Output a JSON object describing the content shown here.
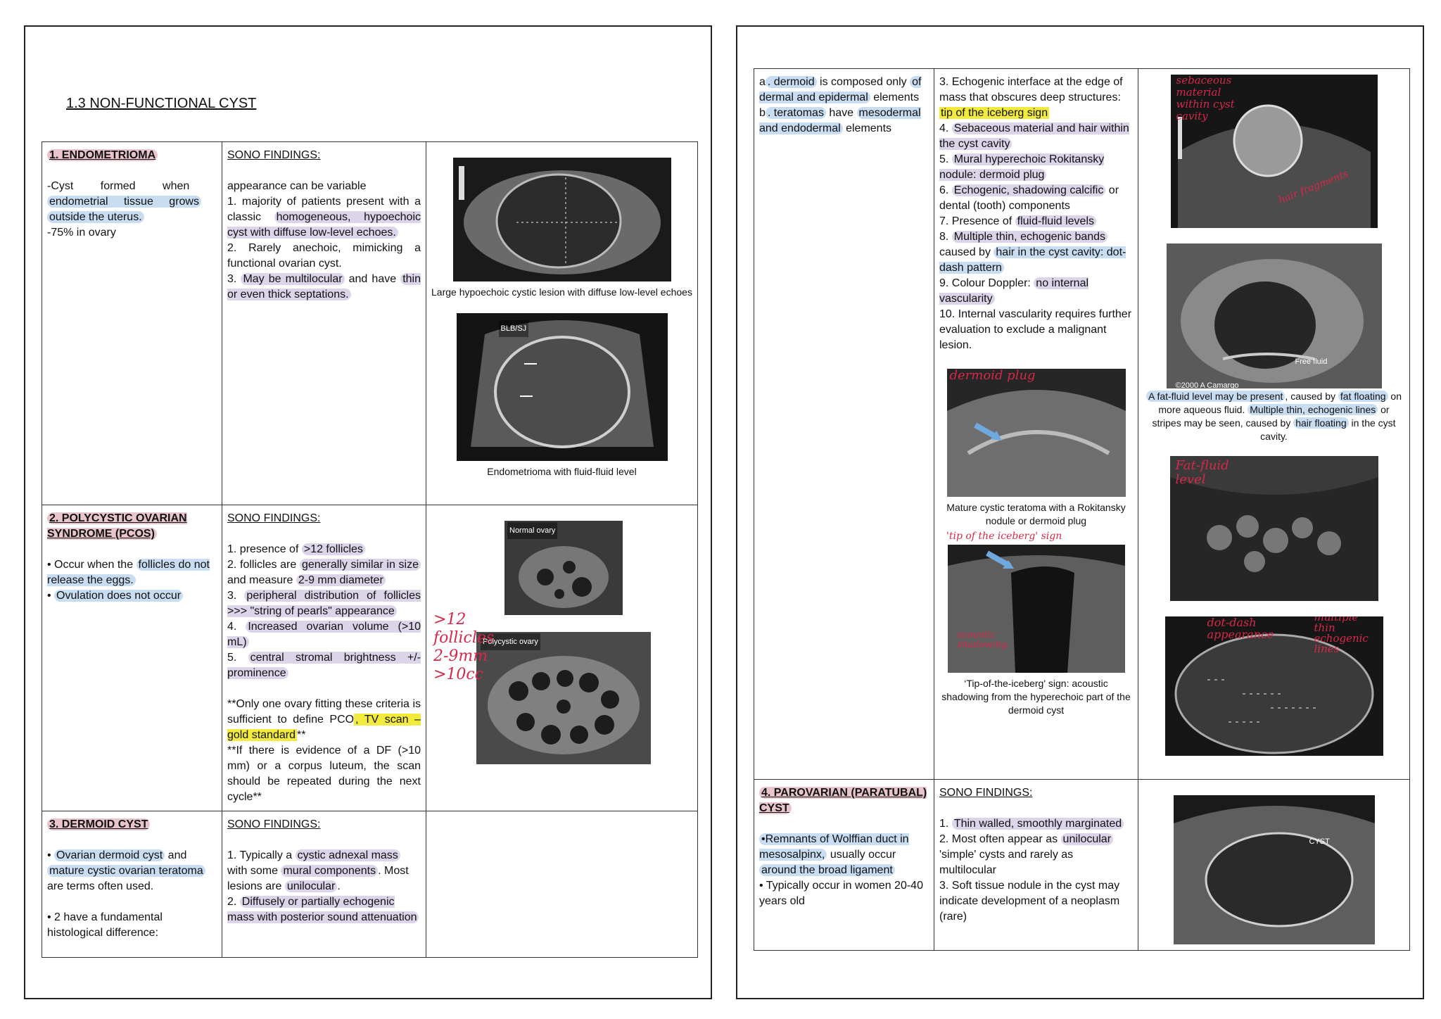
{
  "page1": {
    "title": "1.3 NON-FUNCTIONAL CYST",
    "endometrioma": {
      "heading_num": "1.",
      "heading": "ENDOMETRIOMA",
      "desc1": "-Cyst formed when",
      "desc2": "endometrial tissue grows",
      "desc3": "outside the uterus.",
      "desc4": "-75% in ovary",
      "sono_title": "SONO FINDINGS:",
      "f0": "appearance can be variable",
      "f1a": "1. majority of patients present with a classic ",
      "f1b": "homogeneous, hypoechoic cyst with diffuse low-level echoes.",
      "f2": "2. Rarely anechoic, mimicking a functional ovarian cyst.",
      "f3a": "3. ",
      "f3b": "May be multilocular",
      "f3c": " and have ",
      "f3d": "thin or even thick septations.",
      "caption1": "Large hypoechoic cystic lesion with diffuse low-level echoes",
      "caption2": "Endometrioma with fluid-fluid level",
      "img2_label": "BLB/SJ"
    },
    "pcos": {
      "heading_num": "2.",
      "heading": "POLYCYSTIC OVARIAN SYNDROME (PCOS)",
      "b1a": "• Occur when the ",
      "b1b": "follicles do not release the eggs.",
      "b2": "Ovulation does not occur",
      "b2_bullet": "• ",
      "sono_title": "SONO FINDINGS:",
      "f1a": "1. presence of ",
      "f1b": ">12 follicles",
      "f2a": "2. follicles are ",
      "f2b": "generally similar in size",
      "f2c": " and measure ",
      "f2d": "2-9 mm diameter",
      "f3a": "3. ",
      "f3b": "peripheral distribution of follicles >>> \"string of pearls\" appearance",
      "f4a": "4. ",
      "f4b": "Increased ovarian volume (>10 mL)",
      "f5a": "5. ",
      "f5b": "central stromal brightness +/- prominence",
      "note1a": "**Only one ovary fitting these criteria is sufficient to define PCO",
      "note1b": ", TV scan – gold standard",
      "note1c": "**",
      "note2": "**If there is evidence of a DF (>10 mm) or a corpus luteum, the scan should be repeated during the next cycle**",
      "img1_label": "Normal ovary",
      "img2_label": "Polycystic ovary",
      "scribble": ">12\nfollicles\n2-9mm\n>10cc"
    },
    "dermoid": {
      "heading_num": "3.",
      "heading": "DERMOID CYST",
      "b1a": "• ",
      "b1b": "Ovarian dermoid cyst",
      "b1c": " and ",
      "b1d": "mature cystic ovarian teratoma",
      "b1e": " are terms often used.",
      "b2": "• 2 have a fundamental histological difference:",
      "sono_title": "SONO FINDINGS:",
      "f1a": "1. Typically a ",
      "f1b": "cystic adnexal mass",
      "f1c": " with some ",
      "f1d": "mural components",
      "f1e": ". Most lesions are ",
      "f1f": "unilocular",
      "f1g": ".",
      "f2a": "2. ",
      "f2b": "Diffusely or partially echogenic mass with posterior sound attenuation"
    }
  },
  "page2": {
    "dermoid_cont": {
      "a1": "a",
      "a2": ". dermoid",
      "a3": " is composed only ",
      "a4": "of dermal and epidermal",
      "a5": " elements",
      "b1": "b",
      "b2": ". teratomas",
      "b3": " have ",
      "b4": "mesodermal and endodermal",
      "b5": " elements",
      "f3a": "3. Echogenic interface at the edge of mass that obscures deep structures: ",
      "f3b": "tip of the iceberg sign",
      "f4a": "4. ",
      "f4b": "Sebaceous material and hair within the cyst cavity",
      "f5a": "5. ",
      "f5b": "Mural hyperechoic Rokitansky nodule: dermoid plug",
      "f6a": "6. ",
      "f6b": "Echogenic, shadowing calcific",
      "f6c": " or dental (tooth) components",
      "f7a": "7. Presence of ",
      "f7b": "fluid-fluid levels",
      "f8a": "8. ",
      "f8b": "Multiple thin, echogenic bands",
      "f8c": " caused by ",
      "f8d": "hair in the cyst cavity: dot-dash pattern",
      "f9a": "9. Colour Doppler: ",
      "f9b": "no internal vascularity",
      "f10": "10. Internal vascularity requires further evaluation to exclude a malignant lesion.",
      "cap_plug": "Mature cystic teratoma with a Rokitansky nodule or dermoid plug",
      "cap_iceberg": "‘Tip-of-the-iceberg' sign: acoustic shadowing from the hyperechoic part of the dermoid cyst",
      "scr_plug": "dermoid plug",
      "scr_iceberg": "'tip of the iceberg' sign",
      "scr_acoustic": "acoustic\nshadowing",
      "scr_sebaceous": "sebaceous\nmaterial\nwithin cyst\ncavity",
      "scr_fragments": "hair fragments",
      "scr_fatfluid": "Fat-fluid\nlevel",
      "scr_dotdash": "dot-dash\nappearance",
      "scr_multiple": "multiple\nthin\nechogenic\nlines",
      "img_freefluid": "Free fluid",
      "img_copyright": "©2000 A Camargo",
      "cap_fat1": "A fat-fluid level may be present",
      "cap_fat2": ", caused by ",
      "cap_fat3": "fat floating",
      "cap_fat4": " on more aqueous fluid. ",
      "cap_fat5": "Multiple thin, echogenic lines",
      "cap_fat6": " or stripes may be seen, caused by ",
      "cap_fat7": "hair floating",
      "cap_fat8": " in the cyst cavity."
    },
    "parovarian": {
      "heading_num": "4.",
      "heading": "PAROVARIAN (PARATUBAL) CYST",
      "b1": "•Remnants of Wolffian duct in mesosalpinx,",
      "b1c": " usually occur ",
      "b1d": "around the broad ligament",
      "b2": "• Typically occur in women 20-40 years old",
      "sono_title": "SONO FINDINGS:",
      "f1a": "1. ",
      "f1b": "Thin walled, smoothly marginated",
      "f2a": "2. Most often appear as ",
      "f2b": "unilocular",
      "f2c": " 'simple' cysts and rarely as multilocular",
      "f3": "3. Soft tissue nodule in the cyst may indicate development of a neoplasm (rare)",
      "img_label": "CYST"
    }
  }
}
